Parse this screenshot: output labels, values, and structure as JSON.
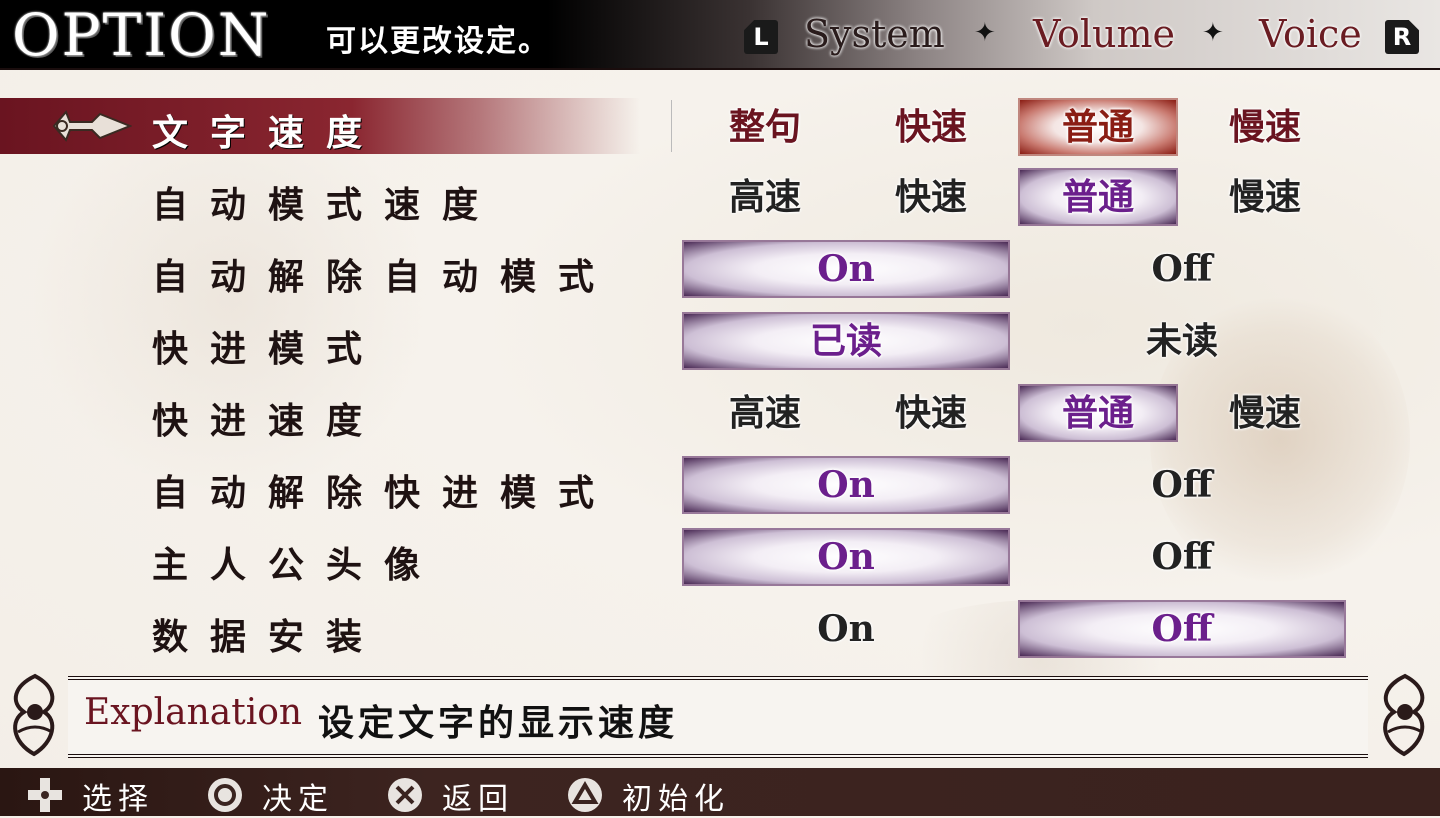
{
  "header": {
    "title": "OPTION",
    "subtitle": "可以更改设定。",
    "left_shoulder": "L",
    "right_shoulder": "R",
    "tabs": [
      "System",
      "Volume",
      "Voice"
    ],
    "separator": "✦"
  },
  "rows": [
    {
      "label": "文字速度",
      "options": [
        "整句",
        "快速",
        "普通",
        "慢速"
      ],
      "selected": "普通",
      "active": true
    },
    {
      "label": "自动模式速度",
      "options": [
        "高速",
        "快速",
        "普通",
        "慢速"
      ],
      "selected": "普通"
    },
    {
      "label": "自动解除自动模式",
      "options": [
        "On",
        "Off"
      ],
      "selected": "On"
    },
    {
      "label": "快进模式",
      "options": [
        "已读",
        "未读"
      ],
      "selected": "已读"
    },
    {
      "label": "快进速度",
      "options": [
        "高速",
        "快速",
        "普通",
        "慢速"
      ],
      "selected": "普通"
    },
    {
      "label": "自动解除快进模式",
      "options": [
        "On",
        "Off"
      ],
      "selected": "On"
    },
    {
      "label": "主人公头像",
      "options": [
        "On",
        "Off"
      ],
      "selected": "On"
    },
    {
      "label": "数据安装",
      "options": [
        "On",
        "Off"
      ],
      "selected": "Off"
    }
  ],
  "explanation": {
    "label": "Explanation",
    "text": "设定文字的显示速度"
  },
  "footer": {
    "hints": [
      {
        "icon": "dpad-icon",
        "label": "选择"
      },
      {
        "icon": "circle-button-icon",
        "label": "决定"
      },
      {
        "icon": "cross-button-icon",
        "label": "返回"
      },
      {
        "icon": "triangle-button-icon",
        "label": "初始化"
      }
    ]
  },
  "colors": {
    "accent_red": "#6a1420",
    "selected_purple": "#6b1f8c",
    "bar_dark": "#2a1612"
  }
}
